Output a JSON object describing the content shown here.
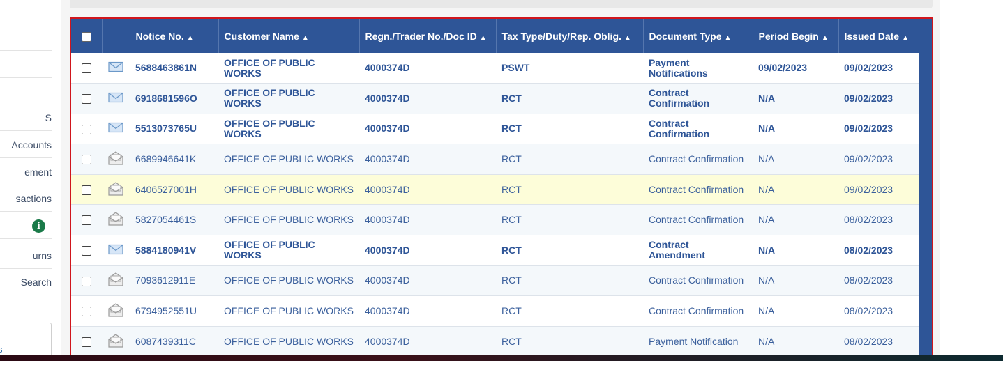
{
  "sidebar": {
    "items": [
      {
        "label": ""
      },
      {
        "label": ""
      },
      {
        "label": ""
      },
      {
        "label": "S"
      },
      {
        "label": "Accounts"
      },
      {
        "label": "ement"
      },
      {
        "label": "sactions"
      },
      {
        "label": ""
      },
      {
        "label": "urns"
      },
      {
        "label": "Search"
      }
    ],
    "box_label": "s"
  },
  "table": {
    "columns": [
      {
        "label": ""
      },
      {
        "label": ""
      },
      {
        "label": "Notice No."
      },
      {
        "label": "Customer Name"
      },
      {
        "label": "Regn./Trader No./Doc ID"
      },
      {
        "label": "Tax Type/Duty/Rep. Oblig."
      },
      {
        "label": "Document Type"
      },
      {
        "label": "Period Begin"
      },
      {
        "label": "Issued Date"
      }
    ],
    "rows": [
      {
        "read": false,
        "notice": "5688463861N",
        "customer": "OFFICE OF PUBLIC WORKS",
        "regn": "4000374D",
        "tax": "PSWT",
        "doctype": "Payment Notifications",
        "period": "09/02/2023",
        "issued": "09/02/2023"
      },
      {
        "read": false,
        "notice": "6918681596O",
        "customer": "OFFICE OF PUBLIC WORKS",
        "regn": "4000374D",
        "tax": "RCT",
        "doctype": "Contract Confirmation",
        "period": "N/A",
        "issued": "09/02/2023"
      },
      {
        "read": false,
        "notice": "5513073765U",
        "customer": "OFFICE OF PUBLIC WORKS",
        "regn": "4000374D",
        "tax": "RCT",
        "doctype": "Contract Confirmation",
        "period": "N/A",
        "issued": "09/02/2023"
      },
      {
        "read": true,
        "notice": "6689946641K",
        "customer": "OFFICE OF PUBLIC WORKS",
        "regn": "4000374D",
        "tax": "RCT",
        "doctype": "Contract Confirmation",
        "period": "N/A",
        "issued": "09/02/2023"
      },
      {
        "read": true,
        "notice": "6406527001H",
        "customer": "OFFICE OF PUBLIC WORKS",
        "regn": "4000374D",
        "tax": "RCT",
        "doctype": "Contract Confirmation",
        "period": "N/A",
        "issued": "09/02/2023"
      },
      {
        "read": true,
        "notice": "5827054461S",
        "customer": "OFFICE OF PUBLIC WORKS",
        "regn": "4000374D",
        "tax": "RCT",
        "doctype": "Contract Confirmation",
        "period": "N/A",
        "issued": "08/02/2023"
      },
      {
        "read": false,
        "notice": "5884180941V",
        "customer": "OFFICE OF PUBLIC WORKS",
        "regn": "4000374D",
        "tax": "RCT",
        "doctype": "Contract Amendment",
        "period": "N/A",
        "issued": "08/02/2023"
      },
      {
        "read": true,
        "notice": "7093612911E",
        "customer": "OFFICE OF PUBLIC WORKS",
        "regn": "4000374D",
        "tax": "RCT",
        "doctype": "Contract Confirmation",
        "period": "N/A",
        "issued": "08/02/2023"
      },
      {
        "read": true,
        "notice": "6794952551U",
        "customer": "OFFICE OF PUBLIC WORKS",
        "regn": "4000374D",
        "tax": "RCT",
        "doctype": "Contract Confirmation",
        "period": "N/A",
        "issued": "08/02/2023"
      },
      {
        "read": true,
        "notice": "6087439311C",
        "customer": "OFFICE OF PUBLIC WORKS",
        "regn": "4000374D",
        "tax": "RCT",
        "doctype": "Payment Notification",
        "period": "N/A",
        "issued": "08/02/2023"
      }
    ]
  },
  "icons": {
    "unread": "envelope-closed-icon",
    "read": "envelope-open-icon",
    "info": "info-icon",
    "sort": "sort-icon"
  },
  "colors": {
    "header_bg": "#2e5597",
    "highlight_border": "#d0161d",
    "highlight_row": "#fdfdd9"
  }
}
